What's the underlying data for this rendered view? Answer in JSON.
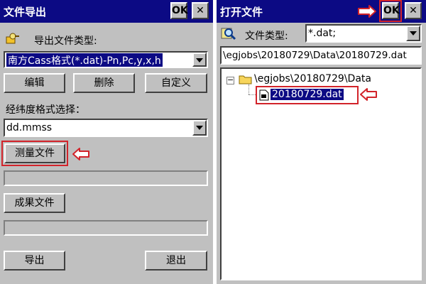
{
  "left_dialog": {
    "title": "文件导出",
    "ok_label": "OK",
    "close_label": "✕",
    "export_type_label": "导出文件类型:",
    "export_type_value": "南方Cass格式(*.dat)-Pn,Pc,y,x,h",
    "edit_label": "编辑",
    "delete_label": "删除",
    "custom_label": "自定义",
    "latlon_format_label": "经纬度格式选择：",
    "latlon_format_value": "dd.mmss",
    "measure_file_label": "测量文件",
    "result_file_label": "成果文件",
    "export_label": "导出",
    "exit_label": "退出"
  },
  "right_dialog": {
    "title": "打开文件",
    "ok_label": "OK",
    "close_label": "✕",
    "file_type_label": "文件类型:",
    "file_type_value": "*.dat;",
    "path_value": "\\egjobs\\20180729\\Data\\20180729.dat",
    "tree": {
      "expander": "−",
      "folder_label": "\\egjobs\\20180729\\Data",
      "file_label": "20180729.dat"
    }
  },
  "colors": {
    "titlebar": "#0c0a84",
    "dialog_bg": "#c0c0c0",
    "highlight": "#d2232a",
    "selection": "#0c0a84"
  },
  "icons": [
    "key-icon",
    "search-icon",
    "folder-icon",
    "file-icon",
    "arrow-left-icon",
    "arrow-right-icon",
    "chevron-down-icon"
  ]
}
